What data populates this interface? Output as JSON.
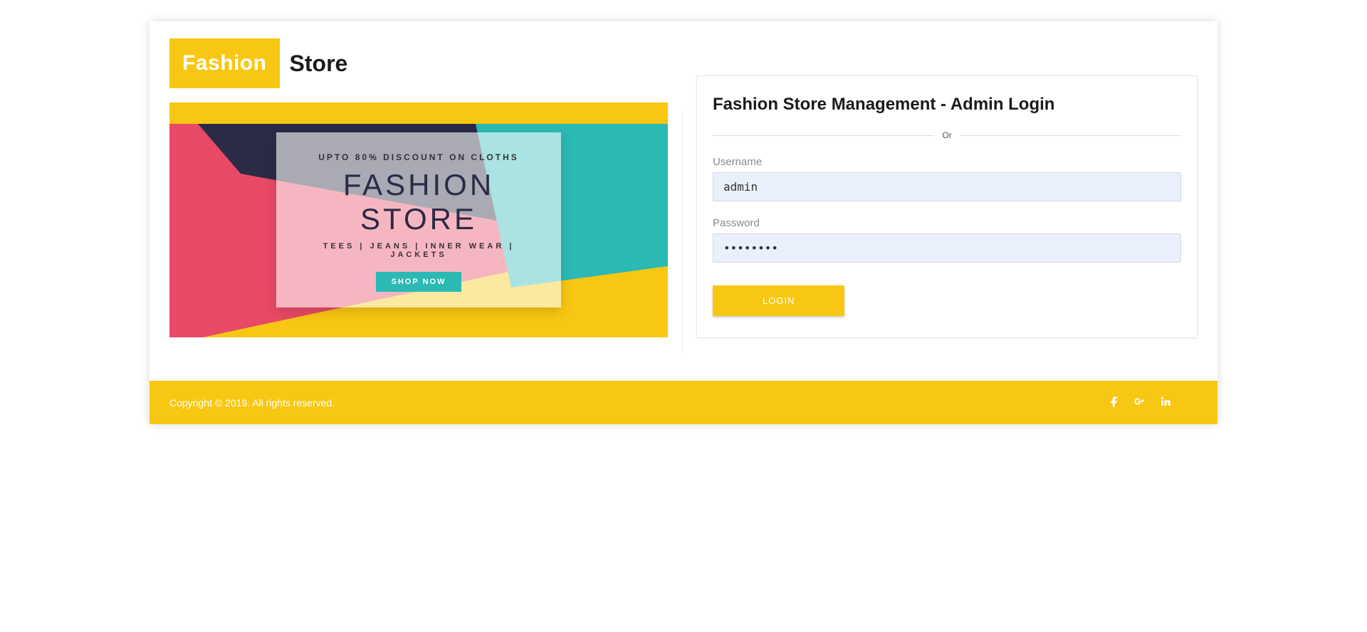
{
  "logo": {
    "brand": "Fashion",
    "text": "Store"
  },
  "banner": {
    "subtitle1": "UPTO 80% DISCOUNT ON CLOTHS",
    "title": "FASHION STORE",
    "subtitle2": "TEES  |  JEANS  |  INNER WEAR  |  JACKETS",
    "button_label": "SHOP NOW"
  },
  "login": {
    "title": "Fashion Store Management - Admin Login",
    "or_text": "Or",
    "username_label": "Username",
    "username_value": "admin",
    "password_label": "Password",
    "password_value": "password",
    "button_label": "LOGIN"
  },
  "footer": {
    "copyright": "Copyright © 2019. All rights reserved."
  },
  "colors": {
    "accent": "#f8c713"
  }
}
